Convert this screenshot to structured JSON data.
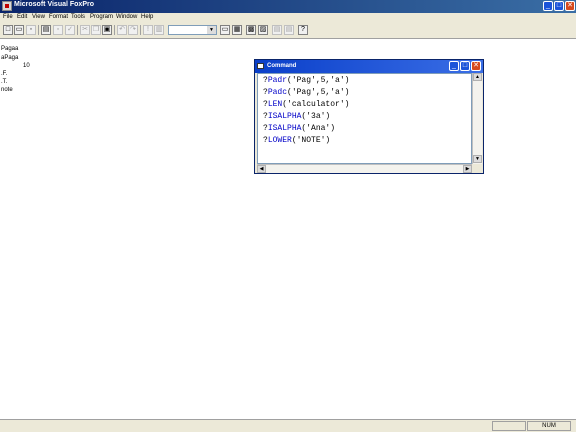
{
  "app": {
    "title": "Microsoft Visual FoxPro"
  },
  "menu": [
    "File",
    "Edit",
    "View",
    "Format",
    "Tools",
    "Program",
    "Window",
    "Help"
  ],
  "output": [
    "Pagaa",
    "aPaga",
    "10",
    ".F.",
    ".T.",
    "note"
  ],
  "command_window": {
    "title": "Command",
    "lines": [
      {
        "prefix": "?",
        "func": "Padr",
        "args": "('Pag',5,'a')"
      },
      {
        "prefix": "?",
        "func": "Padc",
        "args": "('Pag',5,'a')"
      },
      {
        "prefix": "?",
        "func": "LEN",
        "args": "('calculator')"
      },
      {
        "prefix": "?",
        "func": "ISALPHA",
        "args": "('3a')"
      },
      {
        "prefix": "?",
        "func": "ISALPHA",
        "args": "('Ana')"
      },
      {
        "prefix": "?",
        "func": "LOWER",
        "args": "('NOTE')"
      }
    ]
  },
  "status": {
    "num": "NUM"
  },
  "icons": {
    "app": "foxpro-icon",
    "minimize": "minimize-icon",
    "maximize": "maximize-icon",
    "close": "close-icon",
    "toolbar": [
      "new-icon",
      "open-icon",
      "save-icon",
      "print-icon",
      "print-preview-icon",
      "spelling-icon",
      "cut-icon",
      "copy-icon",
      "paste-icon",
      "undo-icon",
      "redo-icon",
      "run-icon",
      "modify-form-icon",
      "database-icon",
      "command-window-icon",
      "data-session-icon",
      "form-designer-icon",
      "report-designer-icon",
      "code-icon",
      "help-icon"
    ]
  },
  "colors": {
    "titlebar": "#0a246a",
    "keyword": "#0000c8",
    "close_button": "#d64a1e"
  }
}
